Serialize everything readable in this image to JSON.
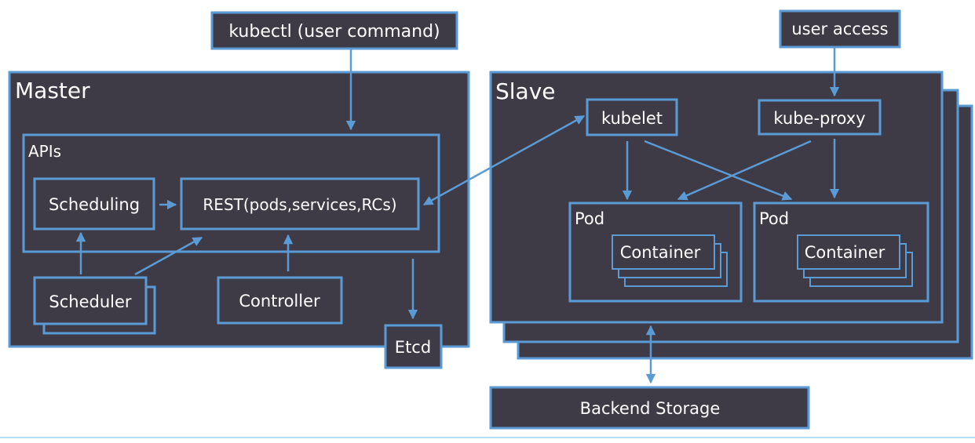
{
  "external": {
    "kubectl": "kubectl (user command)",
    "user_access": "user access",
    "backend_storage": "Backend Storage"
  },
  "master": {
    "title": "Master",
    "apis": "APIs",
    "scheduling": "Scheduling",
    "rest": "REST(pods,services,RCs)",
    "scheduler": "Scheduler",
    "controller": "Controller",
    "etcd": "Etcd"
  },
  "slave": {
    "title": "Slave",
    "kubelet": "kubelet",
    "kube_proxy": "kube-proxy",
    "pods": [
      {
        "label": "Pod",
        "container": "Container"
      },
      {
        "label": "Pod",
        "container": "Container"
      }
    ]
  },
  "colors": {
    "box_fill": "#3e3b47",
    "accent": "#5b9bd5",
    "text": "#ffffff"
  }
}
